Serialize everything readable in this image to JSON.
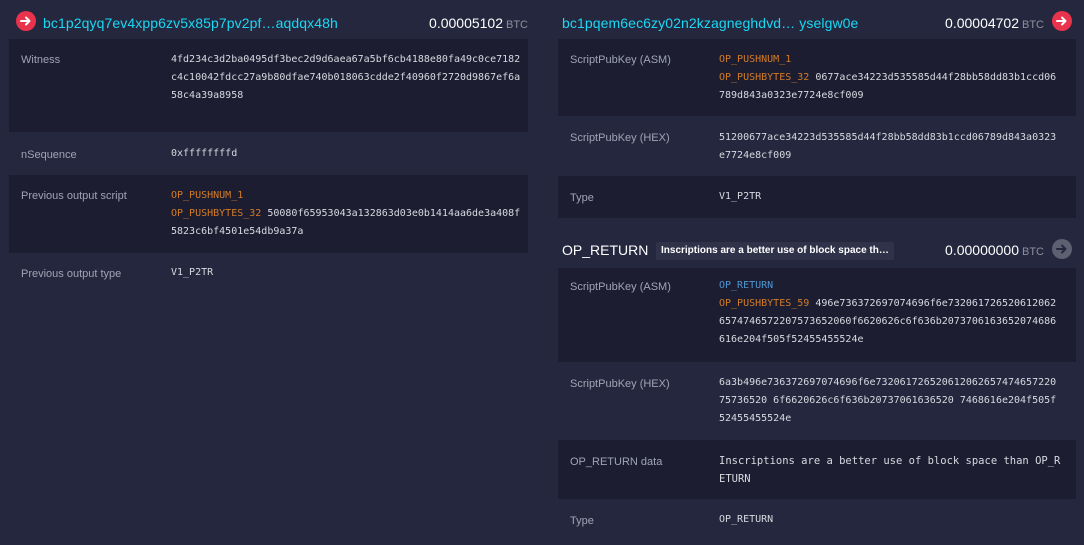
{
  "inputs": {
    "address": "bc1p2qyq7ev4xpp6zv5x85p7pv2pf…aqdqx48h",
    "amount": "0.00005102",
    "unit": "BTC",
    "witness_label": "Witness",
    "witness_value": "4fd234c3d2ba0495df3bec2d9d6aea67a5bf6cb4188e80fa49c0ce7182c4c10042fdcc27a9b80dfae740b018063cdde2f40960f2720d9867ef6a58c4a39a8958",
    "nsequence_label": "nSequence",
    "nsequence_value": "0xffffffffd",
    "prev_script_label": "Previous output script",
    "prev_script_op1": "OP_PUSHNUM_1",
    "prev_script_op2": "OP_PUSHBYTES_32",
    "prev_script_data": "50080f65953043a132863d03e0b1414aa6de3a408f5823c6bf4501e54db9a37a",
    "prev_type_label": "Previous output type",
    "prev_type_value": "V1_P2TR"
  },
  "outputs": {
    "first": {
      "address": "bc1pqem6ec6zy02n2kzagneghdvd… yselgw0e",
      "amount": "0.00004702",
      "unit": "BTC",
      "asm_label": "ScriptPubKey (ASM)",
      "asm_op1": "OP_PUSHNUM_1",
      "asm_op2": "OP_PUSHBYTES_32",
      "asm_data": "0677ace34223d535585d44f28bb58dd83b1ccd06789d843a0323e7724e8cf009",
      "hex_label": "ScriptPubKey (HEX)",
      "hex_value": "51200677ace34223d535585d44f28bb58dd83b1ccd06789d843a0323e7724e8cf009",
      "type_label": "Type",
      "type_value": "V1_P2TR"
    },
    "op_return": {
      "title": "OP_RETURN",
      "badge": "Inscriptions are a better use of block space th…",
      "amount": "0.00000000",
      "unit": "BTC",
      "asm_label": "ScriptPubKey (ASM)",
      "asm_op1": "OP_RETURN",
      "asm_op2": "OP_PUSHBYTES_59",
      "asm_data": "496e736372697074696f6e7320617265206120626574746572207573652060f6620626c6f636b2073706163652074686616e204f505f52455455524e",
      "hex_label": "ScriptPubKey (HEX)",
      "hex_value": "6a3b496e736372697074696f6e73206172652061206265747465722075736520 6f6620626c6f636b20737061636520 7468616e204f505f52455455524e",
      "data_label": "OP_RETURN data",
      "data_value": "Inscriptions are a better use of block space than OP_RETURN",
      "type_label": "Type",
      "type_value": "OP_RETURN"
    }
  },
  "colors": {
    "background": "#24273e",
    "row_dark": "#1c1d31",
    "address": "#1bd8f4",
    "opcode_orange": "#d47b26",
    "opcode_blue": "#4d97d4",
    "arrow_red": "#e9324b"
  }
}
